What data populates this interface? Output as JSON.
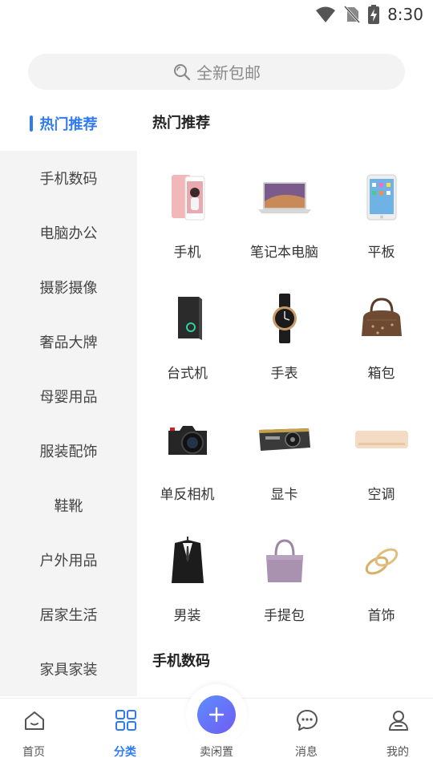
{
  "status": {
    "time": "8:30",
    "icons": [
      "wifi-icon",
      "no-sim-icon",
      "battery-charging-icon"
    ]
  },
  "search": {
    "placeholder": "全新包邮",
    "icon": "search-icon"
  },
  "sidebar": {
    "items": [
      {
        "label": "热门推荐",
        "active": true
      },
      {
        "label": "手机数码"
      },
      {
        "label": "电脑办公"
      },
      {
        "label": "摄影摄像"
      },
      {
        "label": "奢品大牌"
      },
      {
        "label": "母婴用品"
      },
      {
        "label": "服装配饰"
      },
      {
        "label": "鞋靴"
      },
      {
        "label": "户外用品"
      },
      {
        "label": "居家生活"
      },
      {
        "label": "家具家装"
      }
    ]
  },
  "content": {
    "sections": [
      {
        "title": "热门推荐",
        "products": [
          {
            "label": "手机",
            "icon": "phone-icon"
          },
          {
            "label": "笔记本电脑",
            "icon": "laptop-icon"
          },
          {
            "label": "平板",
            "icon": "tablet-icon"
          },
          {
            "label": "台式机",
            "icon": "desktop-tower-icon"
          },
          {
            "label": "手表",
            "icon": "watch-icon"
          },
          {
            "label": "箱包",
            "icon": "handbag-icon"
          },
          {
            "label": "单反相机",
            "icon": "dslr-camera-icon"
          },
          {
            "label": "显卡",
            "icon": "graphics-card-icon"
          },
          {
            "label": "空调",
            "icon": "air-conditioner-icon"
          },
          {
            "label": "男装",
            "icon": "suit-icon"
          },
          {
            "label": "手提包",
            "icon": "tote-bag-icon"
          },
          {
            "label": "首饰",
            "icon": "bracelet-icon"
          }
        ]
      },
      {
        "title": "手机数码",
        "products": []
      }
    ]
  },
  "bottom_nav": {
    "items": [
      {
        "label": "首页",
        "icon": "home-icon"
      },
      {
        "label": "分类",
        "icon": "category-grid-icon",
        "active": true
      },
      {
        "label": "卖闲置",
        "icon": "plus-icon"
      },
      {
        "label": "消息",
        "icon": "message-icon"
      },
      {
        "label": "我的",
        "icon": "profile-icon"
      }
    ]
  },
  "colors": {
    "accent": "#2f7bf5",
    "sidebar_bg": "#f4f4f4",
    "search_bg": "#f3f3f3"
  }
}
